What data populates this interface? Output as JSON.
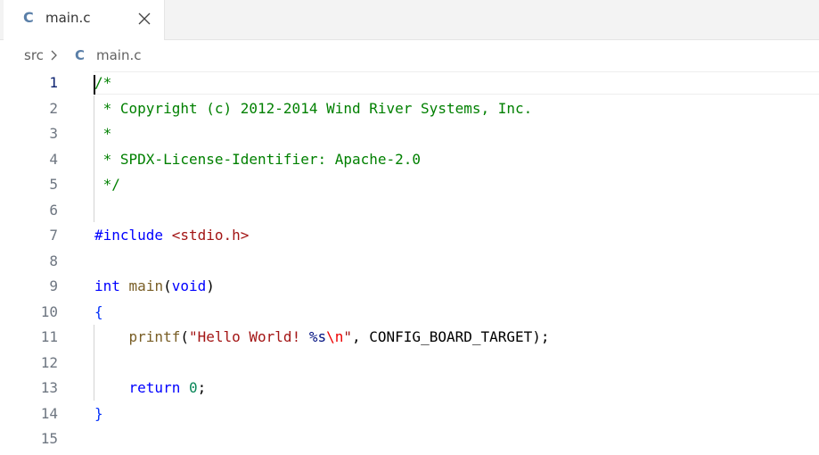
{
  "tab": {
    "icon_letter": "C",
    "label": "main.c",
    "close_icon": "close-icon"
  },
  "breadcrumb": {
    "folder": "src",
    "separator_icon": "chevron-right-icon",
    "file_icon_letter": "C",
    "file": "main.c"
  },
  "editor": {
    "active_line": 1,
    "lines": [
      {
        "number": "1",
        "tokens": [
          {
            "t": "/*",
            "k": "comment"
          }
        ]
      },
      {
        "number": "2",
        "tokens": [
          {
            "t": " * Copyright (c) 2012-2014 Wind River Systems, Inc.",
            "k": "comment"
          }
        ]
      },
      {
        "number": "3",
        "tokens": [
          {
            "t": " *",
            "k": "comment"
          }
        ]
      },
      {
        "number": "4",
        "tokens": [
          {
            "t": " * SPDX-License-Identifier: Apache-2.0",
            "k": "comment"
          }
        ]
      },
      {
        "number": "5",
        "tokens": [
          {
            "t": " */",
            "k": "comment"
          }
        ]
      },
      {
        "number": "6",
        "tokens": []
      },
      {
        "number": "7",
        "tokens": [
          {
            "t": "#include",
            "k": "preproc"
          },
          {
            "t": " ",
            "k": "plain"
          },
          {
            "t": "<stdio.h>",
            "k": "include"
          }
        ]
      },
      {
        "number": "8",
        "tokens": []
      },
      {
        "number": "9",
        "tokens": [
          {
            "t": "int",
            "k": "keyword"
          },
          {
            "t": " ",
            "k": "plain"
          },
          {
            "t": "main",
            "k": "func"
          },
          {
            "t": "(",
            "k": "plain"
          },
          {
            "t": "void",
            "k": "keyword"
          },
          {
            "t": ")",
            "k": "plain"
          }
        ]
      },
      {
        "number": "10",
        "tokens": [
          {
            "t": "{",
            "k": "brace"
          }
        ]
      },
      {
        "number": "11",
        "tokens": [
          {
            "t": "    ",
            "k": "plain"
          },
          {
            "t": "printf",
            "k": "func"
          },
          {
            "t": "(",
            "k": "plain"
          },
          {
            "t": "\"Hello World! ",
            "k": "string"
          },
          {
            "t": "%s",
            "k": "format"
          },
          {
            "t": "\\n",
            "k": "escape"
          },
          {
            "t": "\"",
            "k": "string"
          },
          {
            "t": ", CONFIG_BOARD_TARGET);",
            "k": "plain"
          }
        ]
      },
      {
        "number": "12",
        "tokens": []
      },
      {
        "number": "13",
        "tokens": [
          {
            "t": "    ",
            "k": "plain"
          },
          {
            "t": "return",
            "k": "keyword"
          },
          {
            "t": " ",
            "k": "plain"
          },
          {
            "t": "0",
            "k": "number"
          },
          {
            "t": ";",
            "k": "plain"
          }
        ]
      },
      {
        "number": "14",
        "tokens": [
          {
            "t": "}",
            "k": "brace"
          }
        ]
      },
      {
        "number": "15",
        "tokens": []
      }
    ]
  },
  "colors": {
    "comment": "#008000",
    "keyword": "#0000ff",
    "string": "#a31515",
    "function": "#795e26",
    "number": "#098658",
    "c_icon": "#5a7fa8"
  }
}
